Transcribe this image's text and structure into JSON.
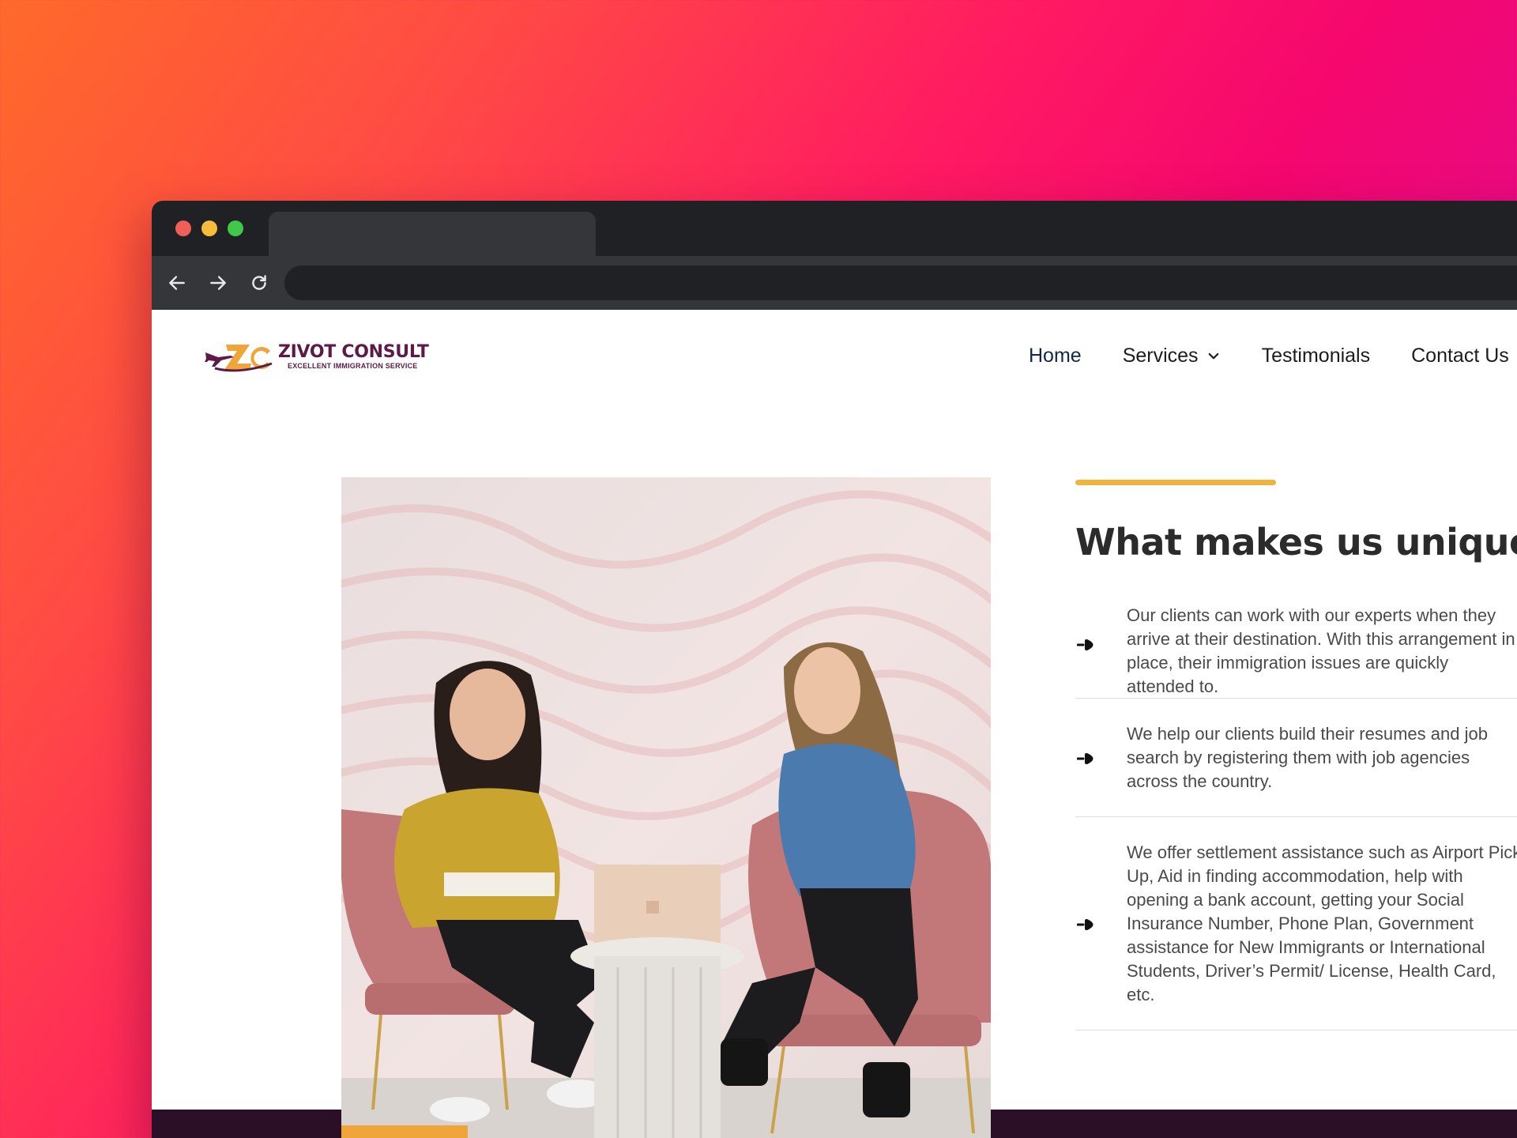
{
  "browser": {
    "tab_title": "",
    "url": ""
  },
  "brand": {
    "name": "ZIVOT CONSULT",
    "tagline": "EXCELLENT IMMIGRATION SERVICE",
    "mark_letters": "ZC"
  },
  "nav": {
    "items": [
      {
        "label": "Home",
        "active": true
      },
      {
        "label": "Services",
        "has_dropdown": true
      },
      {
        "label": "Testimonials"
      },
      {
        "label": "Contact Us"
      }
    ]
  },
  "section": {
    "title": "What makes us unique ?",
    "features": [
      {
        "text": "Our clients can work with our experts when they\narrive at their destination. With this arrangement in\nplace, their immigration issues are quickly\nattended to.",
        "icon": "arrow-right-icon"
      },
      {
        "text": "We help our clients build their resumes and job\nsearch by registering them with job agencies\nacross the country.",
        "icon": "arrow-right-icon"
      },
      {
        "text": "We offer settlement assistance such as Airport Pick-\nUp, Aid in finding accommodation, help with\nopening a bank account, getting your Social\nInsurance Number, Phone Plan, Government\nassistance for New Immigrants or International\nStudents, Driver’s Permit/ License, Health Card,\netc.",
        "icon": "arrow-right-icon"
      }
    ]
  },
  "colors": {
    "brand_purple": "#5d1a49",
    "brand_orange": "#f0a53a",
    "accent_bar": "#f0b43e",
    "footer": "#2b0f26"
  }
}
